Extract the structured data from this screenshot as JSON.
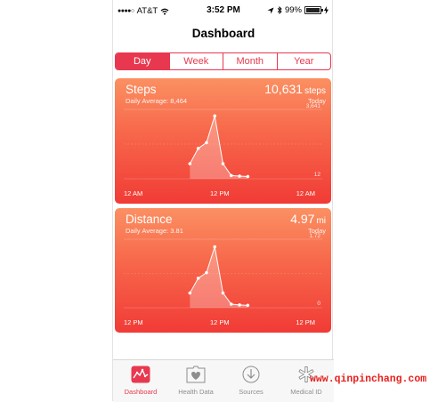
{
  "status_bar": {
    "carrier": "AT&T",
    "time": "3:52 PM",
    "battery": "99%",
    "battery_level": 0.99
  },
  "header": {
    "title": "Dashboard"
  },
  "segments": {
    "tabs": [
      {
        "label": "Day",
        "active": true
      },
      {
        "label": "Week",
        "active": false
      },
      {
        "label": "Month",
        "active": false
      },
      {
        "label": "Year",
        "active": false
      }
    ]
  },
  "cards": {
    "steps": {
      "title": "Steps",
      "average": "Daily Average: 8,464",
      "value": "10,631",
      "unit": "steps",
      "period": "Today",
      "y_max_label": "3,641",
      "y_min_label": "12",
      "x_labels": [
        "12 AM",
        "12 PM",
        "12 AM"
      ]
    },
    "distance": {
      "title": "Distance",
      "average": "Daily Average: 3.81",
      "value": "4.97",
      "unit": "mi",
      "period": "Today",
      "y_max_label": "1.72",
      "y_min_label": "0",
      "x_labels": [
        "12 PM",
        "12 PM",
        "12 PM"
      ]
    }
  },
  "chart_data": [
    {
      "type": "line",
      "title": "Steps",
      "ylim": [
        12,
        3641
      ],
      "x_hours": [
        8,
        9,
        10,
        11,
        12,
        13,
        14,
        15
      ],
      "values": [
        800,
        1600,
        1900,
        3300,
        800,
        180,
        150,
        130
      ]
    },
    {
      "type": "line",
      "title": "Distance",
      "ylim": [
        0,
        1.72
      ],
      "x_hours": [
        8,
        9,
        10,
        11,
        12,
        13,
        14,
        15
      ],
      "values": [
        0.37,
        0.74,
        0.88,
        1.53,
        0.37,
        0.09,
        0.07,
        0.06
      ]
    }
  ],
  "tab_bar": {
    "items": [
      {
        "label": "Dashboard",
        "icon": "dashboard-chart-icon",
        "active": true
      },
      {
        "label": "Health Data",
        "icon": "health-data-heart-icon",
        "active": false
      },
      {
        "label": "Sources",
        "icon": "sources-download-icon",
        "active": false
      },
      {
        "label": "Medical ID",
        "icon": "medical-id-asterisk-icon",
        "active": false
      }
    ]
  },
  "watermark": {
    "text": "www.qinpinchang.com"
  },
  "colors": {
    "accent": "#e8384f",
    "card_top": "#fb9062",
    "card_bottom": "#f13b36",
    "watermark": "#e8201c"
  }
}
